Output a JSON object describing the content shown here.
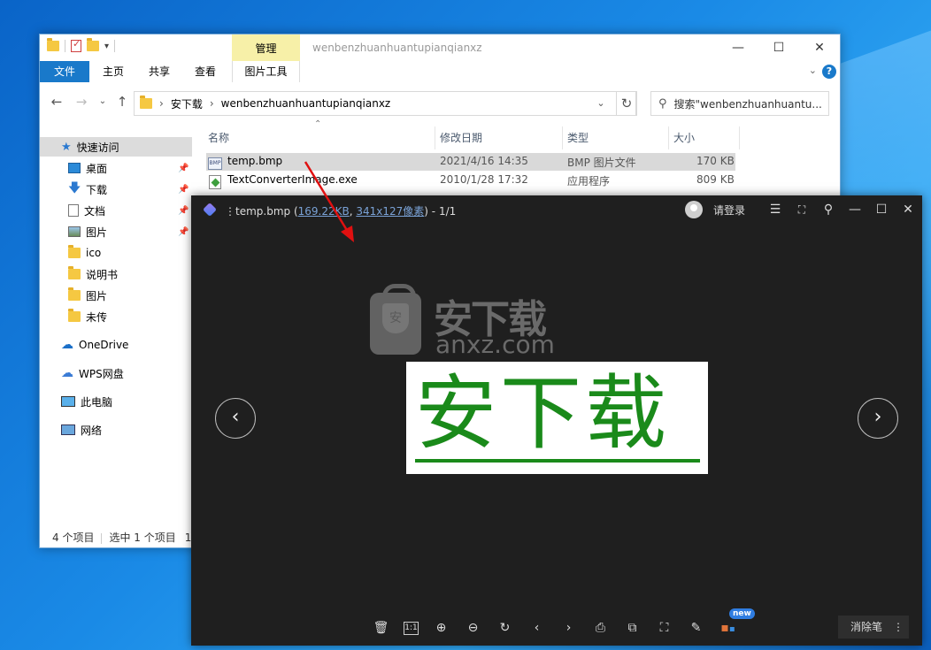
{
  "explorer": {
    "title": "wenbenzhuanhuantupianqianxz",
    "manage_tab": "管理",
    "ribbon_tabs": [
      "文件",
      "主页",
      "共享",
      "查看",
      "图片工具"
    ],
    "address": {
      "crumbs": [
        "安下载",
        "wenbenzhuanhuantupianqianxz"
      ]
    },
    "search_placeholder": "搜索\"wenbenzhuanhuantu...",
    "nav": {
      "quick_access": "快速访问",
      "pinned": [
        "桌面",
        "下载",
        "文档",
        "图片"
      ],
      "folders": [
        "ico",
        "说明书",
        "图片",
        "未传"
      ],
      "onedrive": "OneDrive",
      "wps": "WPS网盘",
      "this_pc": "此电脑",
      "network": "网络"
    },
    "columns": [
      "名称",
      "修改日期",
      "类型",
      "大小"
    ],
    "files": [
      {
        "name": "temp.bmp",
        "date": "2021/4/16 14:35",
        "type": "BMP 图片文件",
        "size": "170 KB"
      },
      {
        "name": "TextConverterImage.exe",
        "date": "2010/1/28 17:32",
        "type": "应用程序",
        "size": "809 KB"
      }
    ],
    "status": {
      "count": "4 个项目",
      "selected": "选中 1 个项目",
      "trail": "1"
    }
  },
  "viewer": {
    "filename": "temp.bmp",
    "filesize": "169.22KB",
    "dimensions": "341x127像素",
    "page": "1/1",
    "login": "请登录",
    "watermark_cn": "安下载",
    "watermark_en": "anxz.com",
    "image_text": "安下载",
    "badge_new": "new",
    "erase_label": "消除笔",
    "colors": {
      "image_text": "#1a8a1a",
      "background": "#1f1f1f"
    }
  }
}
